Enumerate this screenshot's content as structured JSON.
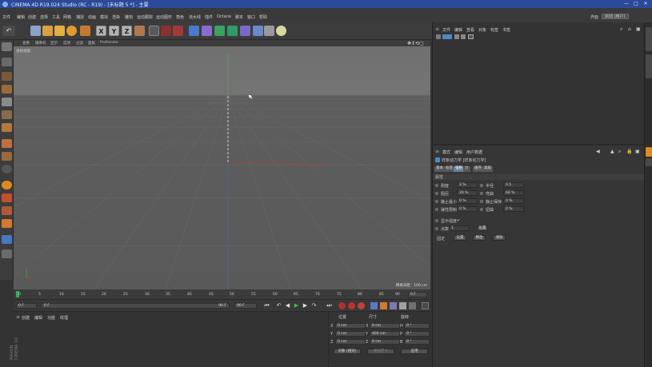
{
  "window": {
    "title": "CINEMA 4D R19.024 Studio (RC - R19) - [未标题 5 *] - 主要",
    "minimize": "—",
    "maximize": "□",
    "close": "✕"
  },
  "menubar": {
    "items": [
      "文件",
      "编辑",
      "创建",
      "选择",
      "工具",
      "网格",
      "捕捉",
      "动画",
      "模拟",
      "渲染",
      "雕刻",
      "运动跟踪",
      "运动图形",
      "角色",
      "流水线",
      "插件",
      "Octane",
      "脚本",
      "窗口",
      "帮助"
    ],
    "layout_label": "界面",
    "layout_value": "启动 (用户)"
  },
  "viewport": {
    "menu": [
      "查看",
      "摄像机",
      "显示",
      "选项",
      "过滤",
      "面板",
      "ProRender"
    ],
    "camera_label": "透视视图",
    "grid_info": "网格间距 : 100 cm"
  },
  "timeline": {
    "ticks": [
      "0",
      "5",
      "10",
      "15",
      "20",
      "25",
      "30",
      "35",
      "40",
      "45",
      "50",
      "55",
      "60",
      "65",
      "70",
      "75",
      "80",
      "85",
      "90"
    ],
    "end_frame_field": "0 F",
    "current_frame": "0 F",
    "start_field": "0 F",
    "end_field": "90 F",
    "end_field2": "90 F"
  },
  "material_panel": {
    "menu": [
      "创建",
      "编辑",
      "功能",
      "纹理"
    ]
  },
  "coordinates": {
    "headers": [
      "位置",
      "尺寸",
      "旋转"
    ],
    "rows": [
      {
        "axis": "X",
        "pos": "0 cm",
        "size": "0 cm",
        "rot_label": "H",
        "rot": "0 °"
      },
      {
        "axis": "Y",
        "pos": "0 cm",
        "size": "400 cm",
        "rot_label": "P",
        "rot": "0 °"
      },
      {
        "axis": "Z",
        "pos": "0 cm",
        "size": "0 cm",
        "rot_label": "B",
        "rot": "0 °"
      }
    ],
    "mode_select": "对象 (相对)",
    "size_select": "绝对尺寸",
    "apply_button": "应用"
  },
  "object_manager": {
    "menu": [
      "文件",
      "编辑",
      "查看",
      "对象",
      "标签",
      "书签"
    ]
  },
  "attributes": {
    "menu": [
      "模式",
      "编辑",
      "用户数据"
    ],
    "object_title": "样条动力学 [样条动力学]",
    "tabs": [
      "基本",
      "标签",
      "强制",
      "力",
      "缓存",
      "高级"
    ],
    "active_tab": "强制",
    "section": "属性",
    "fields_left": [
      {
        "label": "刚度",
        "value": "3 %"
      },
      {
        "label": "阻尼",
        "value": "20 %"
      },
      {
        "label": "静止最小",
        "value": "0 %"
      },
      {
        "label": "弹性限制",
        "value": "0 %"
      }
    ],
    "fields_right": [
      {
        "label": "半径",
        "value": "0.5"
      },
      {
        "label": "弯曲",
        "value": "60 %"
      },
      {
        "label": "静止保持",
        "value": "0 %"
      },
      {
        "label": "扭曲",
        "value": "0 %"
      }
    ],
    "show_label": "显示强度",
    "check_mark": "✔",
    "count_label": "点数",
    "count_value": "1",
    "set_button": "设置",
    "fix_label": "固定",
    "set_btn2": "设置",
    "reset_btn": "释放",
    "clear_btn": "清除"
  },
  "colors": {
    "titlebar": "#2b4a9a",
    "accent_green": "#33aa55",
    "accent_orange": "#e08a1e",
    "red_axis": "#cc3333",
    "green_axis": "#44bb44",
    "blue_axis": "#4466cc"
  }
}
